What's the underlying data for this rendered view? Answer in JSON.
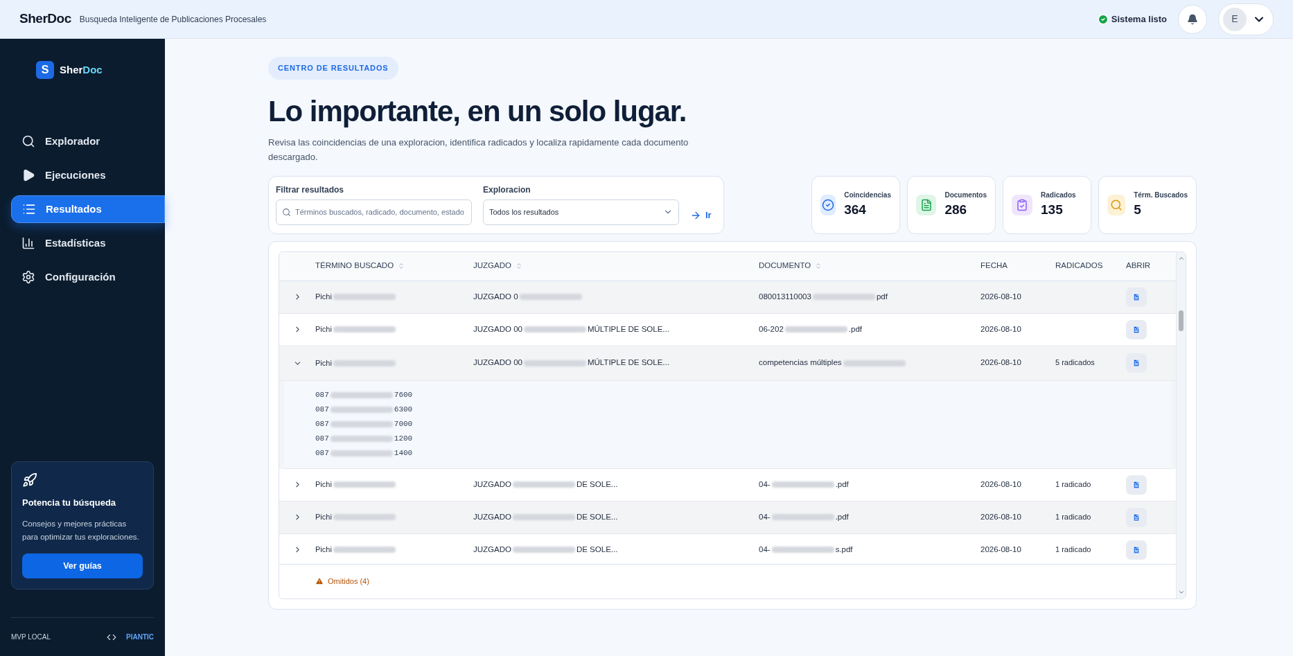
{
  "topbar": {
    "brand": "SherDoc",
    "subtitle": "Busqueda Inteligente de Publicaciones Procesales",
    "status": "Sistema listo",
    "avatar": "E"
  },
  "sidebar": {
    "logo_letter": "S",
    "logo_a": "Sher",
    "logo_b": "Doc",
    "items": [
      {
        "label": "Explorador",
        "selected": false
      },
      {
        "label": "Ejecuciones",
        "selected": false
      },
      {
        "label": "Resultados",
        "selected": true
      },
      {
        "label": "Estadísticas",
        "selected": false
      },
      {
        "label": "Configuración",
        "selected": false
      }
    ],
    "promo": {
      "title": "Potencia tu búsqueda",
      "text": "Consejos y mejores prácticas para optimizar tus exploraciones.",
      "button": "Ver guías"
    },
    "footer_left": "MVP LOCAL",
    "footer_right": "PIANTIC"
  },
  "header": {
    "badge": "CENTRO DE RESULTADOS",
    "title": "Lo importante, en un solo lugar.",
    "description": "Revisa las coincidencias de una exploracion, identifica radicados y localiza rapidamente cada documento descargado."
  },
  "filters": {
    "filter_label": "Filtrar resultados",
    "search_placeholder": "Términos buscados, radicado, documento, estado",
    "exploration_label": "Exploracion",
    "exploration_value": "Todos los resultados",
    "go": "Ir"
  },
  "stats": [
    {
      "label": "Coincidencias",
      "value": "364"
    },
    {
      "label": "Documentos",
      "value": "286"
    },
    {
      "label": "Radicados",
      "value": "135"
    },
    {
      "label": "Térm. Buscados",
      "value": "5"
    }
  ],
  "table": {
    "columns": [
      {
        "label": "TÉRMINO BUSCADO",
        "sortable": true
      },
      {
        "label": "JUZGADO",
        "sortable": true
      },
      {
        "label": "DOCUMENTO",
        "sortable": true
      },
      {
        "label": "FECHA",
        "sortable": false
      },
      {
        "label": "RADICADOS",
        "sortable": false
      },
      {
        "label": "ABRIR",
        "sortable": false
      }
    ],
    "rows": [
      {
        "expanded": false,
        "term": {
          "start": "Pichi"
        },
        "court": {
          "start": "JUZGADO 0"
        },
        "document": {
          "start": "080013110003",
          "end": "pdf"
        },
        "date": "2026-08-10"
      },
      {
        "expanded": false,
        "term": {
          "start": "Pichi"
        },
        "court": {
          "start": "JUZGADO 00",
          "end": "MÚLTIPLE DE SOLE..."
        },
        "document": {
          "start": "06-202",
          "end": ".pdf"
        },
        "date": "2026-08-10"
      },
      {
        "expanded": true,
        "term": {
          "start": "Pichi"
        },
        "court": {
          "start": "JUZGADO 00",
          "end": "MÚLTIPLE DE SOLE..."
        },
        "document": {
          "start": "competencias múltiples"
        },
        "date": "2026-08-10",
        "radicados": "5 radicados",
        "children": [
          {
            "start": "087",
            "end": "7600"
          },
          {
            "start": "087",
            "end": "6300"
          },
          {
            "start": "087",
            "end": "7000"
          },
          {
            "start": "087",
            "end": "1200"
          },
          {
            "start": "087",
            "end": "1400"
          }
        ]
      },
      {
        "expanded": false,
        "term": {
          "start": "Pichi"
        },
        "court": {
          "start": "JUZGADO",
          "end": "DE SOLE..."
        },
        "document": {
          "start": "04-",
          "end": ".pdf"
        },
        "date": "2026-08-10",
        "radicados": "1 radicado"
      },
      {
        "expanded": false,
        "term": {
          "start": "Pichi"
        },
        "court": {
          "start": "JUZGADO",
          "end": "DE SOLE..."
        },
        "document": {
          "start": "04-",
          "end": ".pdf"
        },
        "date": "2026-08-10",
        "radicados": "1 radicado"
      },
      {
        "expanded": false,
        "term": {
          "start": "Pichi"
        },
        "court": {
          "start": "JUZGADO",
          "end": "DE SOLE..."
        },
        "document": {
          "start": "04-",
          "end": "s.pdf"
        },
        "date": "2026-08-10",
        "radicados": "1 radicado"
      }
    ],
    "omitted": "Omitidos (4)"
  }
}
